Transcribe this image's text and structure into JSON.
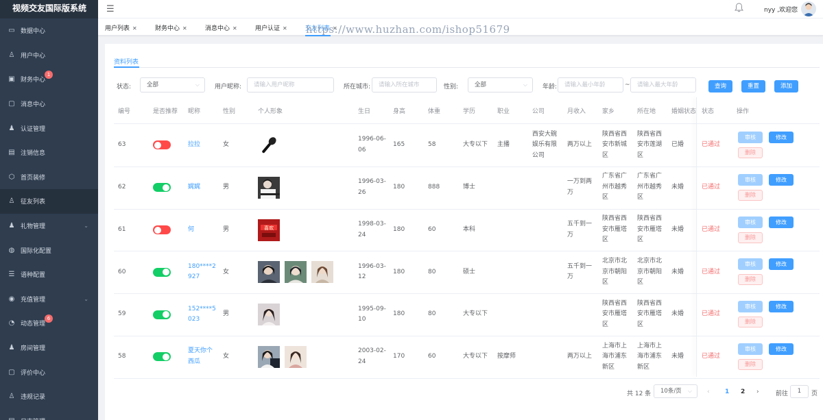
{
  "app": {
    "title": "视频交友国际版系统"
  },
  "sidebar": {
    "items": [
      {
        "label": "数据中心",
        "icon": "monitor-icon"
      },
      {
        "label": "用户中心",
        "icon": "user-icon"
      },
      {
        "label": "财务中心",
        "icon": "wallet-icon",
        "badge": "1"
      },
      {
        "label": "消息中心",
        "icon": "chat-icon"
      },
      {
        "label": "认证管理",
        "icon": "user-fill-icon"
      },
      {
        "label": "注销信息",
        "icon": "document-icon"
      },
      {
        "label": "首页装修",
        "icon": "box-icon"
      },
      {
        "label": "征友列表",
        "icon": "user-icon",
        "active": true
      },
      {
        "label": "礼物管理",
        "icon": "user-fill-icon",
        "expandable": true
      },
      {
        "label": "国际化配置",
        "icon": "globe-icon"
      },
      {
        "label": "语种配置",
        "icon": "list-icon"
      },
      {
        "label": "充值管理",
        "icon": "coins-icon",
        "expandable": true
      },
      {
        "label": "动态管理",
        "icon": "clock-icon",
        "badge": "6"
      },
      {
        "label": "房间管理",
        "icon": "user-fill-icon"
      },
      {
        "label": "评价中心",
        "icon": "chat-icon"
      },
      {
        "label": "违规记录",
        "icon": "user-icon"
      },
      {
        "label": "日志管理",
        "icon": "document-icon"
      }
    ]
  },
  "topbar": {
    "welcome": "nyy ,欢迎您"
  },
  "tabs": [
    {
      "label": "用户列表"
    },
    {
      "label": "财务中心"
    },
    {
      "label": "消息中心"
    },
    {
      "label": "用户认证"
    },
    {
      "label": "交友列表",
      "active": true
    }
  ],
  "watermark": "https://www.huzhan.com/ishop51679",
  "content": {
    "subtab": "资料列表"
  },
  "filters": {
    "status_label": "状态:",
    "status_value": "全部",
    "nickname_label": "用户昵称:",
    "nickname_placeholder": "请输入用户昵称",
    "city_label": "所在城市:",
    "city_placeholder": "请输入所在城市",
    "gender_label": "性别:",
    "gender_value": "全部",
    "age_label": "年龄:",
    "age_min_placeholder": "请输入最小年龄",
    "age_sep": "~",
    "age_max_placeholder": "请输入最大年龄",
    "query": "查询",
    "reset": "重置",
    "add": "添加"
  },
  "table": {
    "columns": [
      "编号",
      "是否推荐",
      "昵称",
      "性别",
      "个人形象",
      "生日",
      "身高",
      "体重",
      "学历",
      "职业",
      "公司",
      "月收入",
      "家乡",
      "所在地",
      "婚姻状态",
      "状态",
      "操作"
    ],
    "audit_label": "审核",
    "edit_label": "修改",
    "delete_label": "删除",
    "rows": [
      {
        "id": "63",
        "recommend": false,
        "nickname": [
          "拉拉"
        ],
        "gender": "女",
        "images": [
          "microphone"
        ],
        "birthday": [
          "1996-06-",
          "06"
        ],
        "height": "165",
        "weight": "58",
        "education": "大专以下",
        "job": "主播",
        "company": [
          "西安大碗",
          "娱乐有限",
          "公司"
        ],
        "income": [
          "两万以上"
        ],
        "hometown": [
          "陕西省西",
          "安市新城",
          "区"
        ],
        "location": [
          "陕西省西",
          "安市莲湖",
          "区"
        ],
        "marital": "已婚",
        "status": "已通过"
      },
      {
        "id": "62",
        "recommend": true,
        "nickname": [
          "娓娓"
        ],
        "gender": "男",
        "images": [
          "photo-piano"
        ],
        "birthday": [
          "1996-03-",
          "26"
        ],
        "height": "180",
        "weight": "888",
        "education": "博士",
        "job": "",
        "company": [],
        "income": [
          "一万到两",
          "万"
        ],
        "hometown": [
          "广东省广",
          "州市越秀",
          "区"
        ],
        "location": [
          "广东省广",
          "州市越秀",
          "区"
        ],
        "marital": "未婚",
        "status": "已通过"
      },
      {
        "id": "61",
        "recommend": false,
        "nickname": [
          "何"
        ],
        "gender": "男",
        "images": [
          "poster-red"
        ],
        "birthday": [
          "1998-03-",
          "24"
        ],
        "height": "180",
        "weight": "60",
        "education": "本科",
        "job": "",
        "company": [],
        "income": [
          "五千到一",
          "万"
        ],
        "hometown": [
          "陕西省西",
          "安市雁塔",
          "区"
        ],
        "location": [
          "陕西省西",
          "安市雁塔",
          "区"
        ],
        "marital": "未婚",
        "status": "已通过"
      },
      {
        "id": "60",
        "recommend": true,
        "nickname": [
          "180****2",
          "927"
        ],
        "gender": "女",
        "images": [
          "portrait-a",
          "portrait-b",
          "portrait-c"
        ],
        "birthday": [
          "1996-03-",
          "12"
        ],
        "height": "180",
        "weight": "80",
        "education": "硕士",
        "job": "",
        "company": [],
        "income": [
          "五千到一",
          "万"
        ],
        "hometown": [
          "北京市北",
          "京市朝阳",
          "区"
        ],
        "location": [
          "北京市北",
          "京市朝阳",
          "区"
        ],
        "marital": "未婚",
        "status": "已通过"
      },
      {
        "id": "59",
        "recommend": true,
        "nickname": [
          "152****5",
          "023"
        ],
        "gender": "男",
        "images": [
          "portrait-d"
        ],
        "birthday": [
          "1995-09-",
          "10"
        ],
        "height": "180",
        "weight": "80",
        "education": "大专以下",
        "job": "",
        "company": [],
        "income": [],
        "hometown": [
          "陕西省西",
          "安市雁塔",
          "区"
        ],
        "location": [
          "陕西省西",
          "安市雁塔",
          "区"
        ],
        "marital": "未婚",
        "status": "已通过"
      },
      {
        "id": "58",
        "recommend": true,
        "nickname": [
          "夏天你个",
          "西瓜"
        ],
        "gender": "女",
        "images": [
          "portrait-e",
          "portrait-f"
        ],
        "birthday": [
          "2003-02-",
          "24"
        ],
        "height": "170",
        "weight": "60",
        "education": "大专以下",
        "job": "按摩师",
        "company": [],
        "income": [
          "两万以上"
        ],
        "hometown": [
          "上海市上",
          "海市浦东",
          "新区"
        ],
        "location": [
          "上海市上",
          "海市浦东",
          "新区"
        ],
        "marital": "未婚",
        "status": "已通过"
      }
    ]
  },
  "pagination": {
    "total": "共 12 条",
    "page_size": "10条/页",
    "pages": [
      "1",
      "2"
    ],
    "current": "1",
    "goto_label": "前往",
    "goto_value": "1",
    "goto_suffix": "页"
  },
  "colors": {
    "sidebar_bg": "#2f3d4f",
    "primary": "#409eff",
    "danger": "#f56c6c",
    "success": "#13ce66"
  }
}
